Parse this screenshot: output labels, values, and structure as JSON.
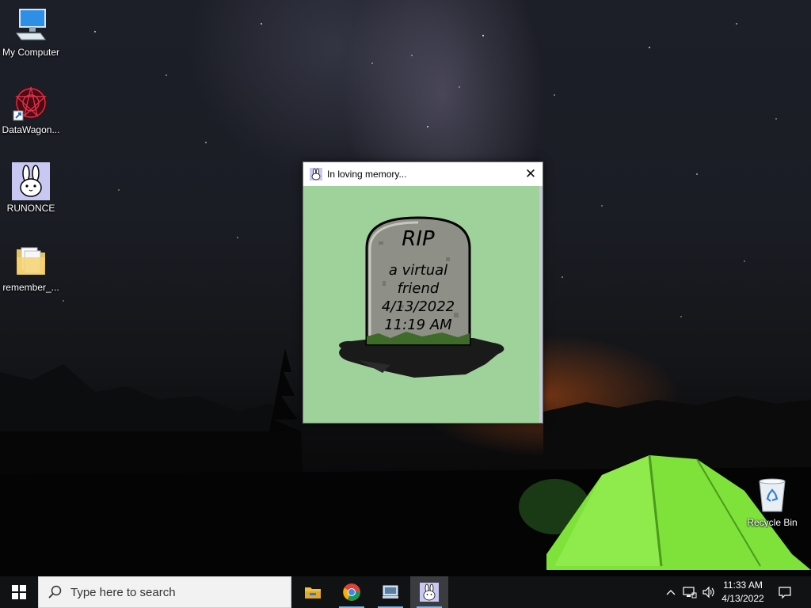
{
  "desktop": {
    "icons": [
      {
        "label": "My Computer",
        "icon": "computer-icon"
      },
      {
        "label": "DataWagon...",
        "icon": "datawagon-icon"
      },
      {
        "label": "RUNONCE",
        "icon": "bunny-icon"
      },
      {
        "label": "remember_...",
        "icon": "folder-icon"
      },
      {
        "label": "Recycle Bin",
        "icon": "recycle-bin-icon"
      }
    ]
  },
  "window": {
    "title": "In loving memory...",
    "close_label": "✕",
    "tombstone": {
      "line1": "RIP",
      "line2": "a virtual",
      "line3": "friend",
      "line4": "4/13/2022",
      "line5": "11:19 AM"
    }
  },
  "taskbar": {
    "search_placeholder": "Type here to search",
    "apps": [
      "file-explorer-icon",
      "chrome-icon",
      "network-app-icon",
      "bunny-app-icon"
    ],
    "clock": {
      "time": "11:33 AM",
      "date": "4/13/2022"
    }
  },
  "colors": {
    "window_bg": "#9fd19a",
    "taskbar_bg": "#111214",
    "tent_green": "#7ee23a"
  }
}
